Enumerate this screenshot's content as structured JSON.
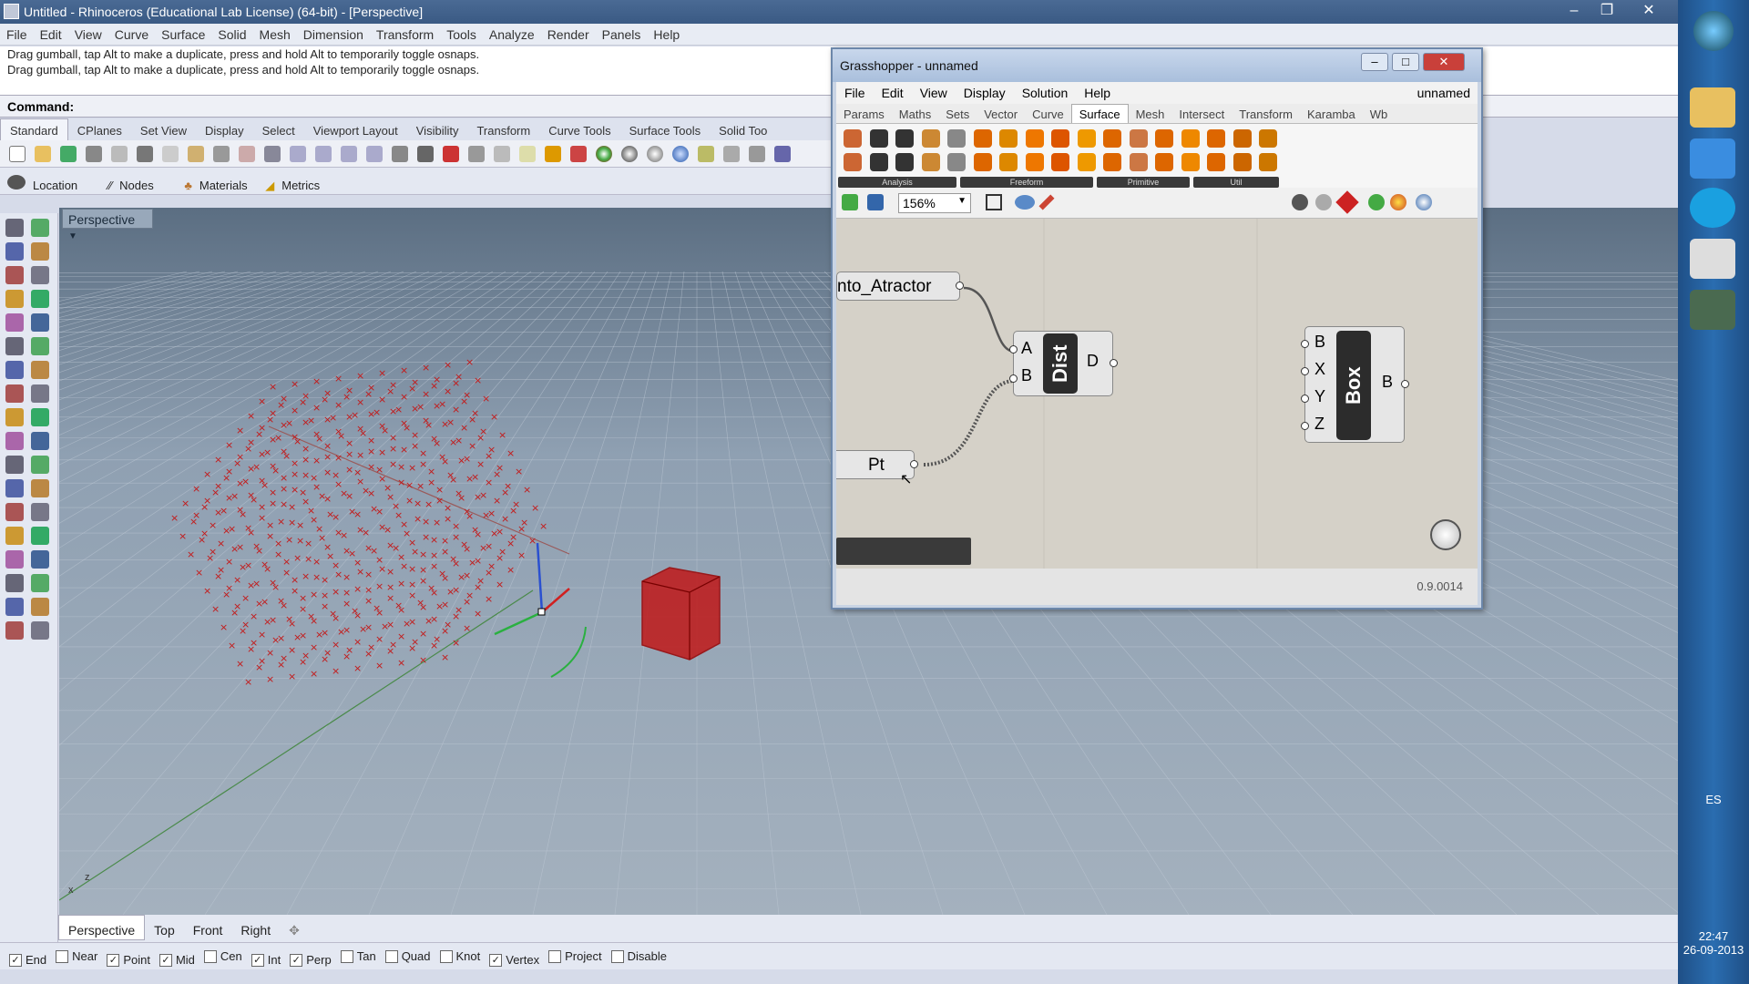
{
  "rhino": {
    "title": "Untitled - Rhinoceros (Educational Lab License) (64-bit) - [Perspective]",
    "menu": [
      "File",
      "Edit",
      "View",
      "Curve",
      "Surface",
      "Solid",
      "Mesh",
      "Dimension",
      "Transform",
      "Tools",
      "Analyze",
      "Render",
      "Panels",
      "Help"
    ],
    "history": [
      "Drag gumball, tap Alt to make a duplicate, press and hold Alt to temporarily toggle osnaps.",
      "Drag gumball, tap Alt to make a duplicate, press and hold Alt to temporarily toggle osnaps."
    ],
    "command_label": "Command:",
    "toolbar_tabs": [
      "Standard",
      "CPlanes",
      "Set View",
      "Display",
      "Select",
      "Viewport Layout",
      "Visibility",
      "Transform",
      "Curve Tools",
      "Surface Tools",
      "Solid Too"
    ],
    "panels": [
      "Location",
      "Nodes",
      "Materials",
      "Metrics"
    ],
    "viewport_label": "Perspective",
    "viewport_tabs": [
      "Perspective",
      "Top",
      "Front",
      "Right"
    ],
    "osnaps": [
      {
        "label": "End",
        "checked": true
      },
      {
        "label": "Near",
        "checked": false
      },
      {
        "label": "Point",
        "checked": true
      },
      {
        "label": "Mid",
        "checked": true
      },
      {
        "label": "Cen",
        "checked": false
      },
      {
        "label": "Int",
        "checked": true
      },
      {
        "label": "Perp",
        "checked": true
      },
      {
        "label": "Tan",
        "checked": false
      },
      {
        "label": "Quad",
        "checked": false
      },
      {
        "label": "Knot",
        "checked": false
      },
      {
        "label": "Vertex",
        "checked": true
      },
      {
        "label": "Project",
        "checked": false
      },
      {
        "label": "Disable",
        "checked": false
      }
    ],
    "axis_labels": {
      "x": "x",
      "z": "z"
    }
  },
  "grasshopper": {
    "title": "Grasshopper - unnamed",
    "menu": [
      "File",
      "Edit",
      "View",
      "Display",
      "Solution",
      "Help"
    ],
    "doc_name": "unnamed",
    "tabs": [
      "Params",
      "Maths",
      "Sets",
      "Vector",
      "Curve",
      "Surface",
      "Mesh",
      "Intersect",
      "Transform",
      "Karamba",
      "Wb"
    ],
    "active_tab": "Surface",
    "groups": [
      "Analysis",
      "Freeform",
      "Primitive",
      "Util"
    ],
    "zoom": "156%",
    "version": "0.9.0014",
    "nodes": {
      "param1": "nto_Atractor",
      "param2": "Pt",
      "dist": {
        "name": "Dist",
        "inputs": [
          "A",
          "B"
        ],
        "output": "D"
      },
      "box": {
        "name": "Box",
        "inputs": [
          "B",
          "X",
          "Y",
          "Z"
        ],
        "output": "B"
      }
    }
  },
  "taskbar": {
    "lang": "ES",
    "time": "22:47",
    "date": "26-09-2013"
  }
}
